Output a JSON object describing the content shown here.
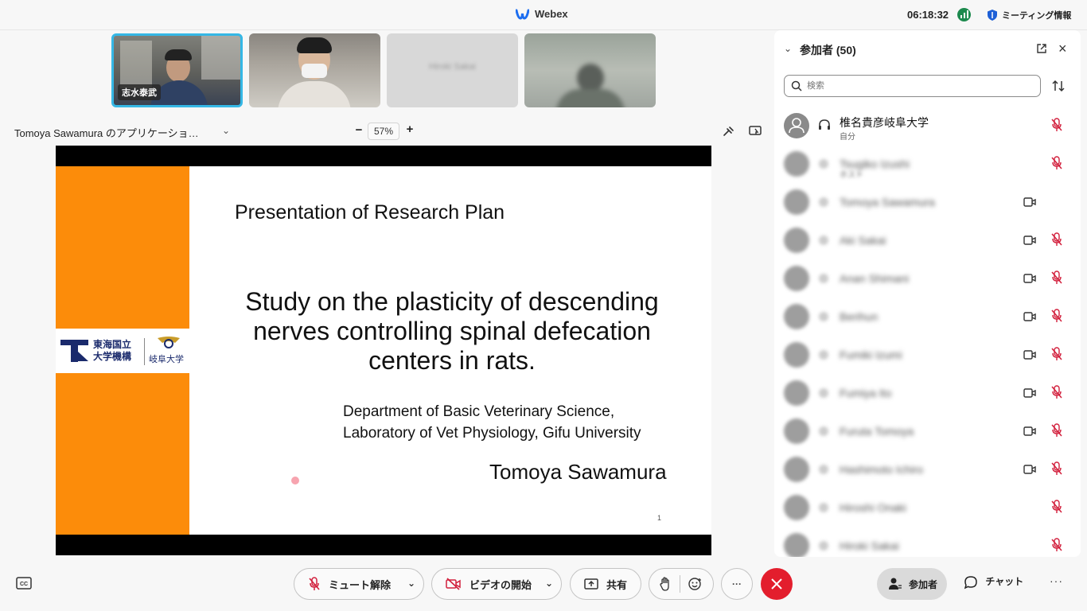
{
  "app": {
    "title": "Webex",
    "clock": "06:18:32",
    "meeting_info": "ミーティング情報"
  },
  "thumbnails": [
    {
      "name": "志水泰武"
    },
    {
      "name": ""
    },
    {
      "name": "Hiroki Sakai"
    },
    {
      "name": ""
    }
  ],
  "share": {
    "title": "Tomoya Sawamura のアプリケーショ…",
    "zoom": "57%",
    "zoom_minus": "−",
    "zoom_plus": "+"
  },
  "slide": {
    "heading": "Presentation of Research Plan",
    "main_title_lines": [
      "Study on the plasticity of descending",
      "nerves controlling spinal defecation",
      "centers in rats."
    ],
    "department_line1": "Department of Basic Veterinary Science,",
    "department_line2": "Laboratory of Vet Physiology, Gifu University",
    "author": "Tomoya Sawamura",
    "page_number": "1",
    "logo_line1": "東海国立",
    "logo_line2": "大学機構",
    "logo_univ": "岐阜大学",
    "orange_color": "#fc8c0a"
  },
  "participants": {
    "header": "参加者 (50)",
    "search_placeholder": "検索",
    "list": [
      {
        "name": "椎名貴彦岐阜大学",
        "sub": "自分",
        "camera": false,
        "muted": true
      },
      {
        "name": "Tsugiko Izushi",
        "sub": "ホスト",
        "camera": false,
        "muted": true
      },
      {
        "name": "Tomoya Sawamura",
        "sub": "",
        "camera": true,
        "muted": false
      },
      {
        "name": "Aki Sakai",
        "sub": "",
        "camera": true,
        "muted": true
      },
      {
        "name": "Anan Shimani",
        "sub": "",
        "camera": true,
        "muted": true
      },
      {
        "name": "Berihun",
        "sub": "",
        "camera": true,
        "muted": true
      },
      {
        "name": "Fumiki Izumi",
        "sub": "",
        "camera": true,
        "muted": true
      },
      {
        "name": "Fumiya Ito",
        "sub": "",
        "camera": true,
        "muted": true
      },
      {
        "name": "Furuta Tomoya",
        "sub": "",
        "camera": true,
        "muted": true
      },
      {
        "name": "Hashimoto Ichiro",
        "sub": "",
        "camera": true,
        "muted": true
      },
      {
        "name": "Hiroshi Onaki",
        "sub": "",
        "camera": false,
        "muted": true
      },
      {
        "name": "Hiroki Sakai",
        "sub": "",
        "camera": false,
        "muted": true
      }
    ]
  },
  "controls": {
    "unmute": "ミュート解除",
    "start_video": "ビデオの開始",
    "share": "共有",
    "more": "···",
    "participants": "参加者",
    "chat": "チャット",
    "overflow": "···"
  },
  "colors": {
    "end_call": "#e31e2d",
    "active_border": "#35b7e5",
    "mute_red": "#d21f3c"
  }
}
